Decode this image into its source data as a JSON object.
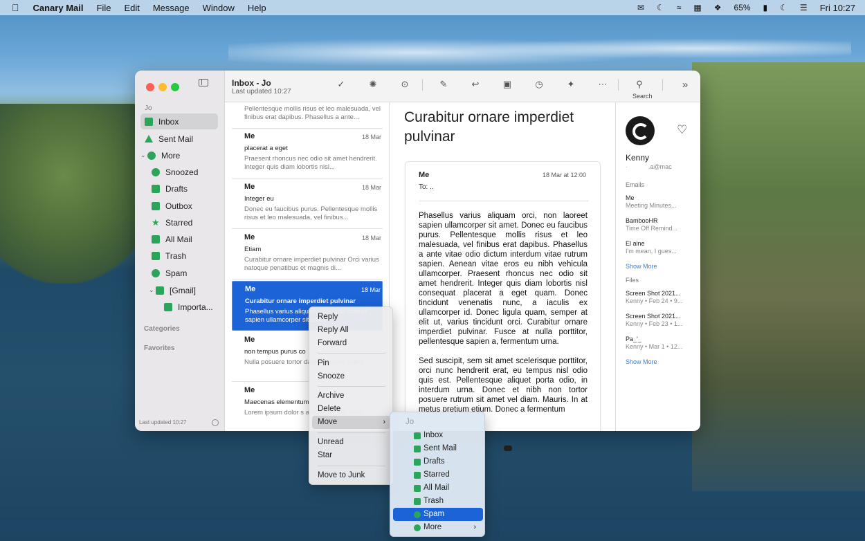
{
  "menubar": {
    "app_name": "Canary Mail",
    "menus": [
      "File",
      "Edit",
      "Message",
      "Window",
      "Help"
    ],
    "battery": "65%",
    "clock": "Fri 10:27"
  },
  "sidebar": {
    "account": "Jo",
    "folders": {
      "inbox": "Inbox",
      "sent": "Sent Mail",
      "more": "More",
      "snoozed": "Snoozed",
      "drafts": "Drafts",
      "outbox": "Outbox",
      "starred": "Starred",
      "allmail": "All Mail",
      "trash": "Trash",
      "spam": "Spam",
      "gmail": "[Gmail]",
      "important": "Importa..."
    },
    "categories": "Categories",
    "favorites": "Favorites",
    "footer": "Last updated 10:27"
  },
  "toolbar": {
    "title": "Inbox - Jo",
    "subtitle": "Last updated 10:27",
    "search_label": "Search"
  },
  "messages": [
    {
      "from": "",
      "date": "",
      "subject": "",
      "preview": "Pellentesque mollis risus et leo malesuada, vel finibus erat dapibus. Phasellus a ante..."
    },
    {
      "from": "Me",
      "date": "18 Mar",
      "subject": "placerat a eget",
      "preview": "Praesent rhoncus nec odio sit amet hendrerit. Integer quis diam lobortis nisl..."
    },
    {
      "from": "Me",
      "date": "18 Mar",
      "subject": "Integer eu",
      "preview": "Donec eu faucibus purus. Pellentesque mollis risus et leo malesuada, vel finibus..."
    },
    {
      "from": "Me",
      "date": "18 Mar",
      "subject": "Etiam",
      "preview": "Curabitur ornare imperdiet pulvinar Orci varius natoque penatibus et magnis di..."
    },
    {
      "from": "Me",
      "date": "18 Mar",
      "subject": "Curabitur ornare imperdiet pulvinar",
      "preview": "Phasellus varius aliquam orci, non laoreet sapien ullamcorper sit amet."
    },
    {
      "from": "Me",
      "date": "",
      "subject": "non tempus purus co",
      "preview": "Nulla posuere tortor  dapibus lorem sollici"
    },
    {
      "from": "Me",
      "date": "",
      "subject": "Maecenas elementum",
      "preview": "Lorem ipsum dolor s adipiscing elit. Aliqu"
    }
  ],
  "reader": {
    "subject": "Curabitur ornare imperdiet pulvinar",
    "from": "Me",
    "date": "18 Mar at 12:00",
    "to": "To:  ..",
    "body_p1": "Phasellus varius aliquam orci, non laoreet sapien ullamcorper sit amet. Donec eu faucibus purus. Pellentesque mollis risus et leo malesuada, vel finibus erat dapibus. Phasellus a ante vitae odio dictum interdum vitae rutrum sapien. Aenean vitae eros eu nibh vehicula ullamcorper. Praesent rhoncus nec odio sit amet hendrerit. Integer quis diam lobortis nisl consequat placerat a eget quam. Donec tincidunt venenatis nunc, a iaculis ex ullamcorper id. Donec ligula quam, semper at elit ut, varius tincidunt orci. Curabitur ornare imperdiet pulvinar. Fusce at nulla porttitor, pellentesque sapien a, fermentum urna.",
    "body_p2": "Sed suscipit, sem sit amet scelerisque porttitor, orci nunc hendrerit erat, eu tempus nisl odio quis est. Pellentesque aliquet porta odio, in interdum urna. Donec et nibh non tortor posuere rutrum sit amet vel diam. Mauris. In at metus pretium etium. Donec a fermentum"
  },
  "contact": {
    "name": "Kenny",
    "email": "a@mac",
    "emails_label": "Emails",
    "emails": [
      {
        "from": "Me",
        "subject": "Meeting Minutes..."
      },
      {
        "from": "BambooHR",
        "subject": "Time Off Remind..."
      },
      {
        "from": "El aine",
        "subject": "I'm mean, I gues..."
      }
    ],
    "show_more": "Show More",
    "files_label": "Files",
    "files": [
      {
        "name": "Screen Shot 2021...",
        "meta": "Kenny • Feb 24 • 9..."
      },
      {
        "name": "Screen Shot 2021...",
        "meta": "Kenny • Feb 23 • 1..."
      },
      {
        "name": "Pa_'_",
        "meta": "Kenny • Mar 1 • 12..."
      }
    ]
  },
  "context_menu": {
    "reply": "Reply",
    "reply_all": "Reply All",
    "forward": "Forward",
    "pin": "Pin",
    "snooze": "Snooze",
    "archive": "Archive",
    "delete": "Delete",
    "move": "Move",
    "unread": "Unread",
    "star": "Star",
    "junk": "Move to Junk"
  },
  "move_submenu": {
    "header": "Jo",
    "items": [
      "Inbox",
      "Sent Mail",
      "Drafts",
      "Starred",
      "All Mail",
      "Trash",
      "Spam",
      "More"
    ],
    "highlighted": "Spam"
  },
  "colors": {
    "accent": "#1d63d8",
    "folder_icon": "#2aa55a"
  }
}
